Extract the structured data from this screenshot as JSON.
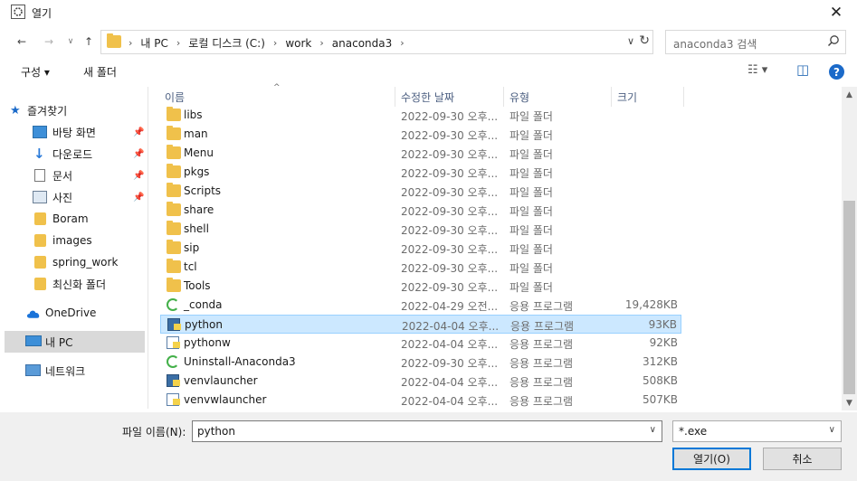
{
  "window": {
    "title": "열기",
    "close_glyph": "✕"
  },
  "nav": {
    "back": "←",
    "forward": "→",
    "recent": "∨",
    "up": "↑"
  },
  "address": {
    "crumbs": [
      "내 PC",
      "로컬 디스크 (C:)",
      "work",
      "anaconda3"
    ],
    "separator": "›",
    "dropdown": "∨",
    "refresh": "↻"
  },
  "search": {
    "placeholder": "anaconda3 검색",
    "icon": "search-icon"
  },
  "toolbar": {
    "organize": "구성 ▾",
    "new_folder": "새 폴더",
    "view_glyph": "☷ ▾",
    "pane_glyph": "◫",
    "help": "?"
  },
  "sidebar": {
    "items": [
      {
        "label": "즐겨찾기",
        "icon": "star-icon",
        "pinned": false
      },
      {
        "label": "바탕 화면",
        "icon": "desktop-icon",
        "pinned": true
      },
      {
        "label": "다운로드",
        "icon": "download-icon",
        "pinned": true
      },
      {
        "label": "문서",
        "icon": "document-icon",
        "pinned": true
      },
      {
        "label": "사진",
        "icon": "picture-icon",
        "pinned": true
      },
      {
        "label": "Boram",
        "icon": "folder-icon",
        "pinned": false
      },
      {
        "label": "images",
        "icon": "folder-icon",
        "pinned": false
      },
      {
        "label": "spring_work",
        "icon": "folder-icon",
        "pinned": false
      },
      {
        "label": "최신화 폴더",
        "icon": "folder-icon",
        "pinned": false
      },
      {
        "label": "OneDrive",
        "icon": "cloud-icon",
        "pinned": false
      },
      {
        "label": "내 PC",
        "icon": "computer-icon",
        "pinned": false
      },
      {
        "label": "네트워크",
        "icon": "network-icon",
        "pinned": false
      }
    ],
    "pin_glyph": "📌"
  },
  "columns": {
    "name": "이름",
    "date": "수정한 날짜",
    "type": "유형",
    "size": "크기"
  },
  "files": [
    {
      "name": "libs",
      "date": "2022-09-30 오후...",
      "type": "파일 폴더",
      "size": "",
      "kind": "folder"
    },
    {
      "name": "man",
      "date": "2022-09-30 오후...",
      "type": "파일 폴더",
      "size": "",
      "kind": "folder"
    },
    {
      "name": "Menu",
      "date": "2022-09-30 오후...",
      "type": "파일 폴더",
      "size": "",
      "kind": "folder"
    },
    {
      "name": "pkgs",
      "date": "2022-09-30 오후...",
      "type": "파일 폴더",
      "size": "",
      "kind": "folder"
    },
    {
      "name": "Scripts",
      "date": "2022-09-30 오후...",
      "type": "파일 폴더",
      "size": "",
      "kind": "folder"
    },
    {
      "name": "share",
      "date": "2022-09-30 오후...",
      "type": "파일 폴더",
      "size": "",
      "kind": "folder"
    },
    {
      "name": "shell",
      "date": "2022-09-30 오후...",
      "type": "파일 폴더",
      "size": "",
      "kind": "folder"
    },
    {
      "name": "sip",
      "date": "2022-09-30 오후...",
      "type": "파일 폴더",
      "size": "",
      "kind": "folder"
    },
    {
      "name": "tcl",
      "date": "2022-09-30 오후...",
      "type": "파일 폴더",
      "size": "",
      "kind": "folder"
    },
    {
      "name": "Tools",
      "date": "2022-09-30 오후...",
      "type": "파일 폴더",
      "size": "",
      "kind": "folder"
    },
    {
      "name": "_conda",
      "date": "2022-04-29 오전...",
      "type": "응용 프로그램",
      "size": "19,428KB",
      "kind": "conda"
    },
    {
      "name": "python",
      "date": "2022-04-04 오후...",
      "type": "응용 프로그램",
      "size": "93KB",
      "kind": "python",
      "selected": true
    },
    {
      "name": "pythonw",
      "date": "2022-04-04 오후...",
      "type": "응용 프로그램",
      "size": "92KB",
      "kind": "pythonw"
    },
    {
      "name": "Uninstall-Anaconda3",
      "date": "2022-09-30 오후...",
      "type": "응용 프로그램",
      "size": "312KB",
      "kind": "conda"
    },
    {
      "name": "venvlauncher",
      "date": "2022-04-04 오후...",
      "type": "응용 프로그램",
      "size": "508KB",
      "kind": "python"
    },
    {
      "name": "venvwlauncher",
      "date": "2022-04-04 오후...",
      "type": "응용 프로그램",
      "size": "507KB",
      "kind": "pythonw"
    }
  ],
  "filename": {
    "label": "파일 이름(N):",
    "value": "python"
  },
  "filter": {
    "value": "*.exe"
  },
  "buttons": {
    "open": "열기(O)",
    "cancel": "취소"
  },
  "colors": {
    "selection": "#cce8ff",
    "selection_border": "#99d1ff",
    "accent": "#0078d7",
    "folder": "#f0c14b"
  }
}
